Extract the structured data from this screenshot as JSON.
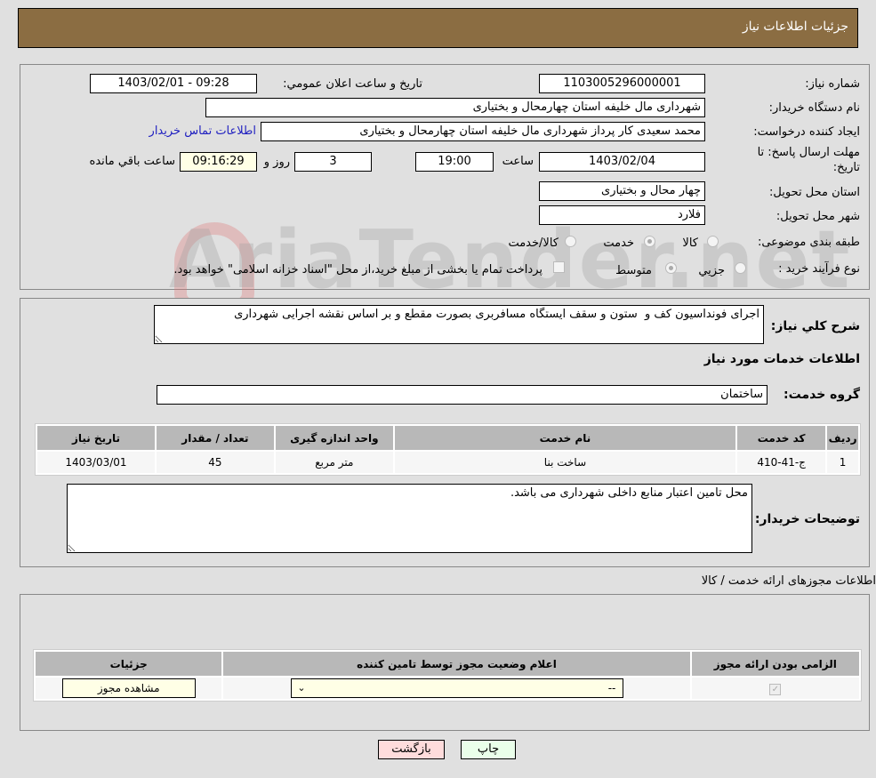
{
  "header": {
    "title": "جزئیات اطلاعات نیاز"
  },
  "form": {
    "need_number": {
      "label": "شماره نیاز:",
      "value": "1103005296000001"
    },
    "announce_datetime": {
      "label": "تاریخ و ساعت اعلان عمومي:",
      "value": "1403/02/01 - 09:28"
    },
    "buyer_org": {
      "label": "نام دستگاه خریدار:",
      "value": "شهرداری مال خلیفه استان چهارمحال و بختیاری"
    },
    "requester": {
      "label": "ایجاد کننده درخواست:",
      "value": "محمد سعیدی کار پرداز شهرداری مال خلیفه استان چهارمحال و بختیاری"
    },
    "contact_link": "اطلاعات تماس خریدار",
    "deadline": {
      "label": "مهلت ارسال پاسخ: تا تاریخ:",
      "date": "1403/02/04",
      "time_label": "ساعت",
      "time": "19:00",
      "days": "3",
      "days_label": "روز و",
      "remaining": "09:16:29",
      "remaining_label": "ساعت باقي مانده"
    },
    "province": {
      "label": "استان محل تحویل:",
      "value": "چهار محال و بختیاری"
    },
    "city": {
      "label": "شهر محل تحویل:",
      "value": "فلارد"
    },
    "category": {
      "label": "طبقه بندی موضوعی:",
      "options": [
        "کالا",
        "خدمت",
        "کالا/خدمت"
      ],
      "selected": "خدمت"
    },
    "purchase_process": {
      "label": "نوع فرآیند خرید :",
      "options": [
        "جزيي",
        "متوسط"
      ],
      "selected": "متوسط",
      "treasury_note": "پرداخت تمام یا بخشی از مبلغ خرید،از محل \"اسناد خزانه اسلامی\" خواهد بود."
    }
  },
  "description": {
    "label": "شرح كلي نیاز:",
    "value": "اجرای فونداسیون کف و  ستون و سقف ایستگاه مسافربری بصورت مقطع و بر اساس نقشه اجرایی شهرداری"
  },
  "services": {
    "title": "اطلاعات خدمات مورد نیاز",
    "group_label": "گروه خدمت:",
    "group_value": "ساختمان",
    "columns": [
      "ردیف",
      "کد خدمت",
      "نام خدمت",
      "واحد اندازه گیری",
      "تعداد / مقدار",
      "تاریخ نیاز"
    ],
    "rows": [
      [
        "1",
        "ج-41-410",
        "ساخت بنا",
        "متر مربع",
        "45",
        "1403/03/01"
      ]
    ]
  },
  "buyer_notes": {
    "label": "توضیحات خریدار:",
    "value": "محل تامین اعتبار منابع داخلی شهرداری می باشد."
  },
  "permits": {
    "title": "اطلاعات مجوزهای ارائه خدمت / کالا",
    "columns": [
      "الزامی بودن ارائه مجوز",
      "اعلام وضعیت مجوز توسط تامین کننده",
      "جزئیات"
    ],
    "row": {
      "required_checked": true,
      "status_value": "--",
      "view_button": "مشاهده مجوز"
    }
  },
  "footer": {
    "print_button": "چاپ",
    "back_button": "بازگشت"
  },
  "watermark": "AriaTender.net"
}
